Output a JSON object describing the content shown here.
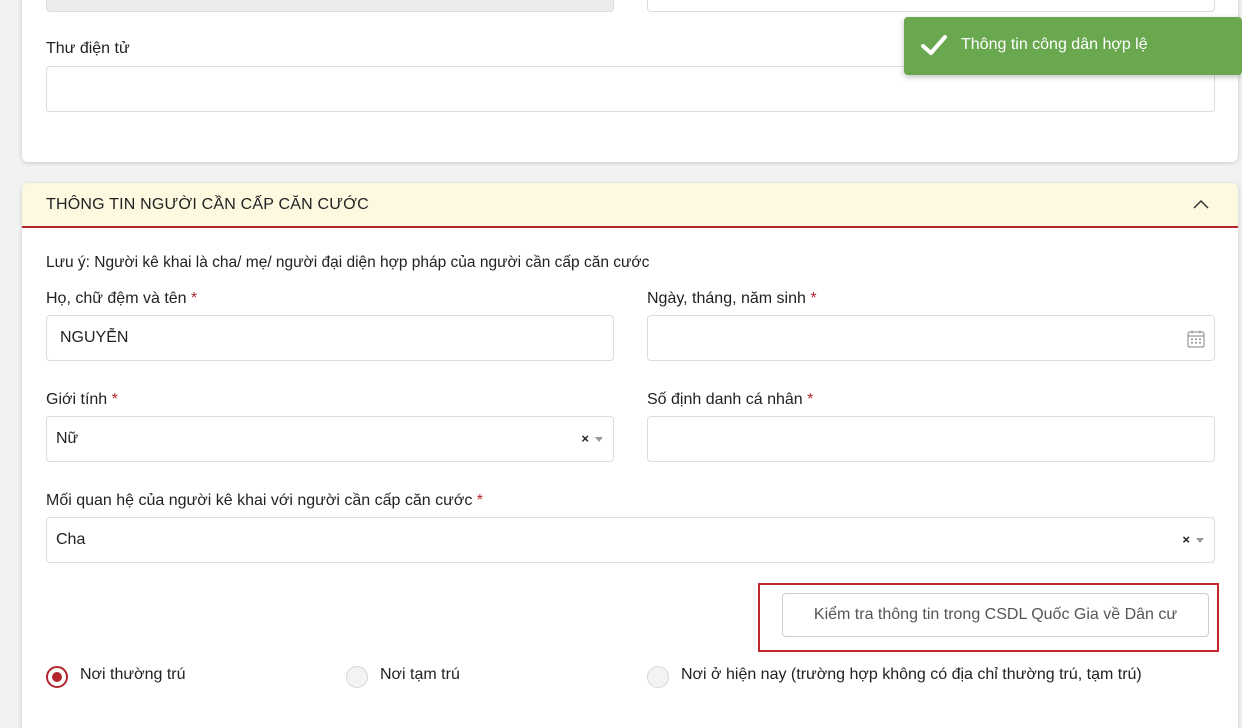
{
  "toast": {
    "icon": "check-icon",
    "message": "Thông tin công dân hợp lệ",
    "color": "#6aa84f"
  },
  "contact": {
    "email_label": "Thư điện tử",
    "email_value": ""
  },
  "section": {
    "title": "THÔNG TIN NGƯỜI CẦN CẤP CĂN CƯỚC",
    "collapse_icon": "chevron-up-icon",
    "note": "Lưu ý: Người kê khai là cha/ mẹ/ người đại diện hợp pháp của người cần cấp căn cước",
    "required_mark": "*",
    "fields": {
      "full_name": {
        "label": "Họ, chữ đệm và tên",
        "value": "NGUYỄN"
      },
      "dob": {
        "label": "Ngày, tháng, năm sinh",
        "value": "",
        "icon": "calendar-icon"
      },
      "gender": {
        "label": "Giới tính",
        "value": "Nữ"
      },
      "personal_id": {
        "label": "Số định danh cá nhân",
        "value": ""
      },
      "relationship": {
        "label": "Mối quan hệ của người kê khai với người cần cấp căn cước",
        "value": "Cha"
      }
    },
    "clear_glyph": "×",
    "check_button_label": "Kiểm tra thông tin trong CSDL Quốc Gia về Dân cư",
    "residence_options": [
      {
        "label": "Nơi thường trú",
        "selected": true
      },
      {
        "label": "Nơi tạm trú",
        "selected": false
      },
      {
        "label": "Nơi ở hiện nay (trường hợp không có địa chỉ thường trú, tạm trú)",
        "selected": false
      }
    ],
    "accent_color": "#b3262d"
  }
}
